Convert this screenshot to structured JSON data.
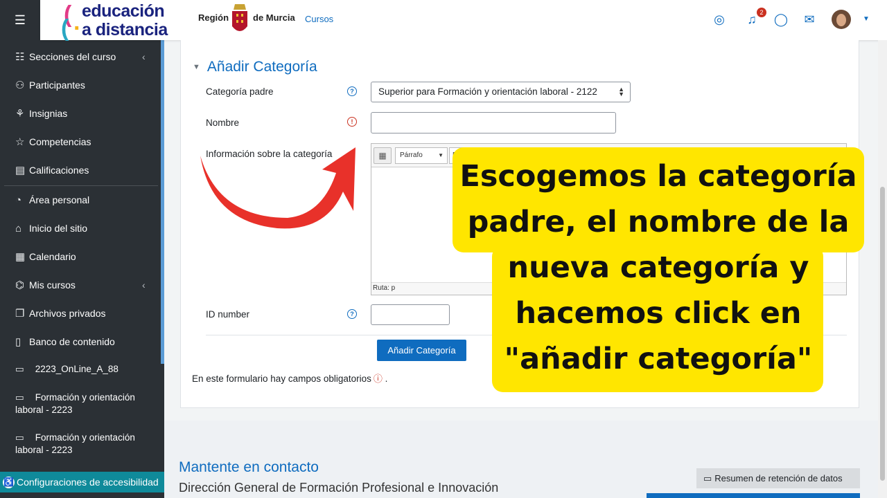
{
  "sidebar": {
    "items": [
      {
        "label": "Secciones del curso",
        "icon": "list-icon"
      },
      {
        "label": "Participantes",
        "icon": "users-icon"
      },
      {
        "label": "Insignias",
        "icon": "badge-icon"
      },
      {
        "label": "Competencias",
        "icon": "star-icon"
      },
      {
        "label": "Calificaciones",
        "icon": "grades-icon"
      },
      {
        "label": "Área personal",
        "icon": "dashboard-icon"
      },
      {
        "label": "Inicio del sitio",
        "icon": "home-icon"
      },
      {
        "label": "Calendario",
        "icon": "calendar-icon"
      },
      {
        "label": "Mis cursos",
        "icon": "cap-icon"
      },
      {
        "label": "Archivos privados",
        "icon": "file-icon"
      },
      {
        "label": "Banco de contenido",
        "icon": "paste-icon"
      }
    ],
    "courses": [
      {
        "label": "2223_OnLine_A_88"
      },
      {
        "label": "Formación y orientación laboral - 2223"
      },
      {
        "label": "Formación y orientación laboral - 2223"
      }
    ],
    "accessibility_label": "Configuraciones de accesibilidad"
  },
  "header": {
    "logo_line1": "educación",
    "logo_line2": "a distancia",
    "region_left": "Región",
    "region_right": "de Murcia",
    "courses_link": "Cursos",
    "notification_count": "2"
  },
  "form": {
    "section_title": "Añadir Categoría",
    "parent_label": "Categoría padre",
    "parent_value": "Superior para Formación y orientación laboral - 2122",
    "name_label": "Nombre",
    "info_label": "Información sobre la categoría",
    "editor_format": "Párrafo",
    "editor_path": "Ruta: p",
    "idnumber_label": "ID number",
    "submit_label": "Añadir Categoría",
    "required_note": "En este formulario hay campos obligatorios",
    "required_note_end": "."
  },
  "footer": {
    "contact_title": "Mantente en contacto",
    "direction": "Dirección General de Formación Profesional e Innovación",
    "retention_label": "Resumen de retención de datos"
  },
  "callout": {
    "lines": [
      "Escogemos la categoría",
      "padre, el nombre de la",
      "nueva categoría y",
      "hacemos click en",
      "\"añadir categoría\""
    ]
  },
  "colors": {
    "accent": "#0f6cbf",
    "sidebar": "#2b3035",
    "callout": "#ffe600",
    "arrow": "#e8312a"
  }
}
